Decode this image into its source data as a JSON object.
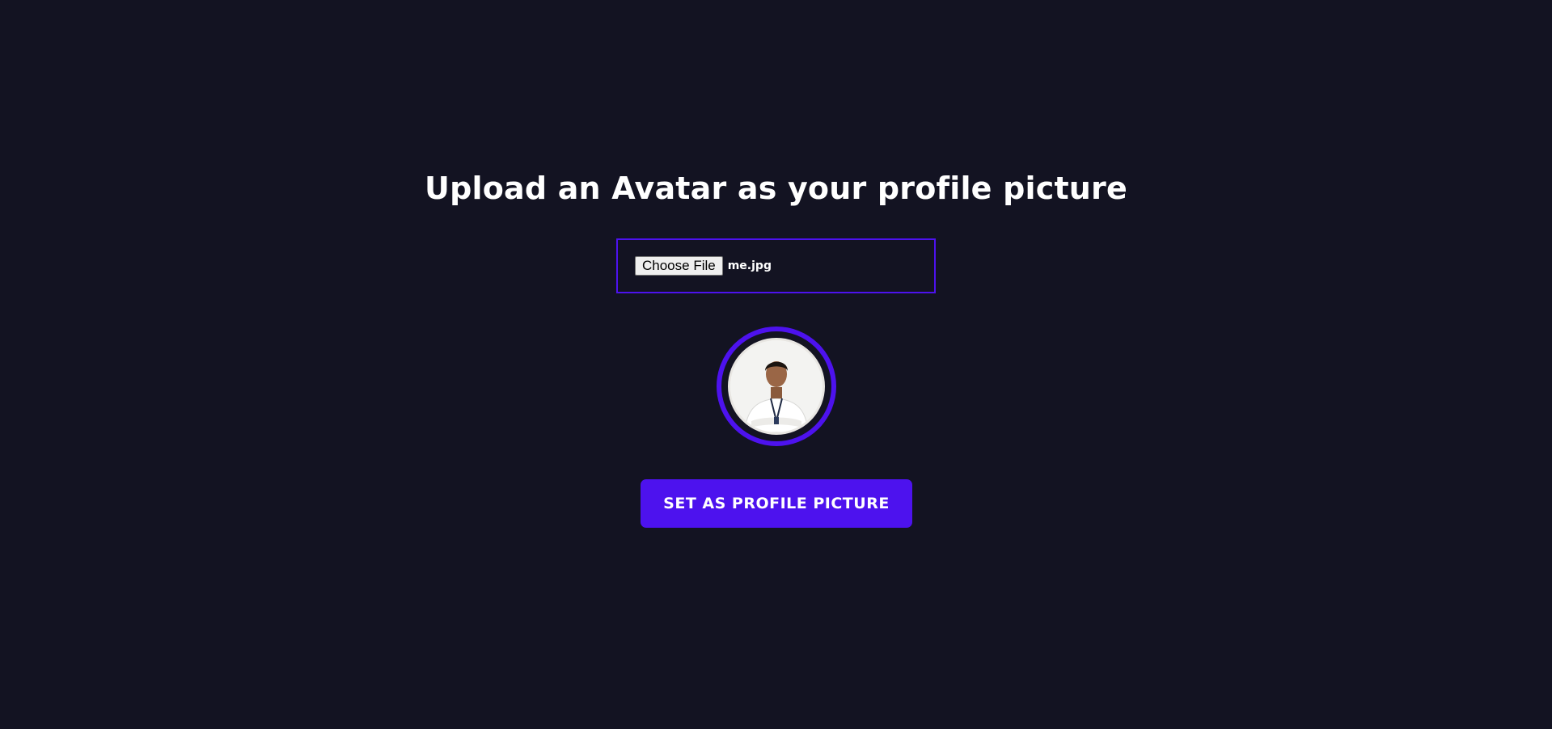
{
  "page": {
    "title": "Upload an Avatar as your profile picture"
  },
  "file_input": {
    "button_label": "Choose File",
    "selected_file": "me.jpg"
  },
  "avatar": {
    "icon": "profile-photo"
  },
  "submit": {
    "label": "SET AS PROFILE PICTURE"
  },
  "colors": {
    "background": "#131322",
    "accent": "#4d12ee",
    "text": "#ffffff"
  }
}
